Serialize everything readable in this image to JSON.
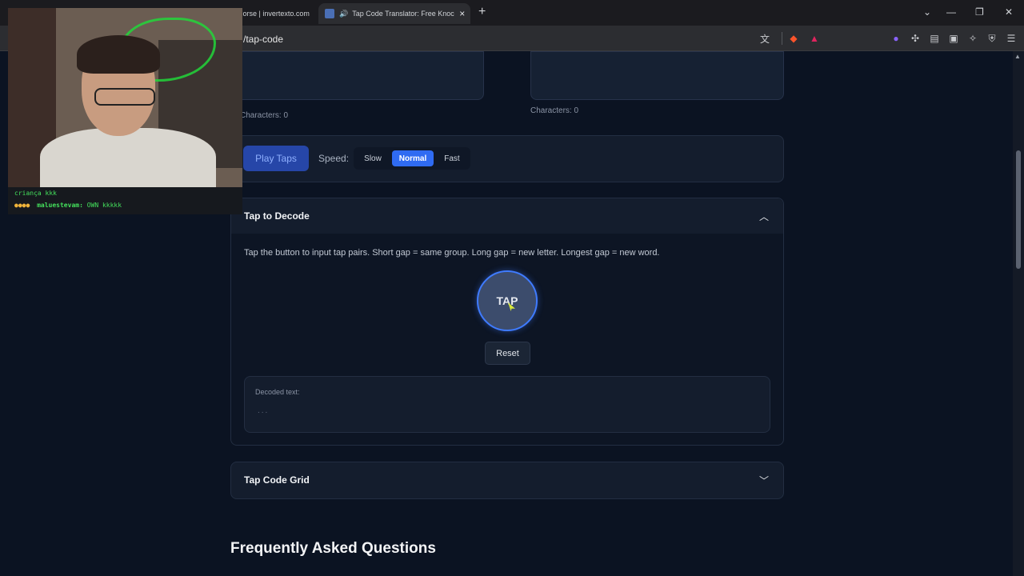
{
  "browser": {
    "tabs": [
      {
        "title": "Morse | invertexto.com",
        "active": false
      },
      {
        "title": "Tap Code Translator: Free Knock Co",
        "active": true
      }
    ],
    "new_tab": "+",
    "url": "/tap-code",
    "window_controls": {
      "dropdown": "⌄",
      "minimize": "—",
      "restore": "❐",
      "close": "✕"
    }
  },
  "toolbar_icons": [
    "translate-icon",
    "brave-shield-icon",
    "brave-rewards-icon",
    "drop-icon",
    "extensions-icon",
    "sidebar-icon",
    "wallet-icon",
    "leo-icon",
    "vpn-icon",
    "menu-icon"
  ],
  "encode": {
    "input_char_count": "Characters: 0",
    "output_char_count": "Characters: 0",
    "play_label": "Play Taps",
    "speed_label": "Speed:",
    "speed_options": [
      "Slow",
      "Normal",
      "Fast"
    ],
    "speed_selected": "Normal"
  },
  "decode": {
    "title": "Tap to Decode",
    "instructions": "Tap the button to input tap pairs. Short gap = same group. Long gap = new letter. Longest gap = new word.",
    "tap_label": "TAP",
    "reset_label": "Reset",
    "decoded_label": "Decoded text:",
    "decoded_value": "..."
  },
  "grid": {
    "title": "Tap Code Grid"
  },
  "faq": {
    "title": "Frequently Asked Questions"
  },
  "chat": {
    "line1": "criança kkk",
    "user": "maluestevam:",
    "message": "OWN kkkkk"
  },
  "colors": {
    "page_bg": "#0b1322",
    "accent": "#2f6bf2",
    "card_bg": "#141d2d"
  }
}
